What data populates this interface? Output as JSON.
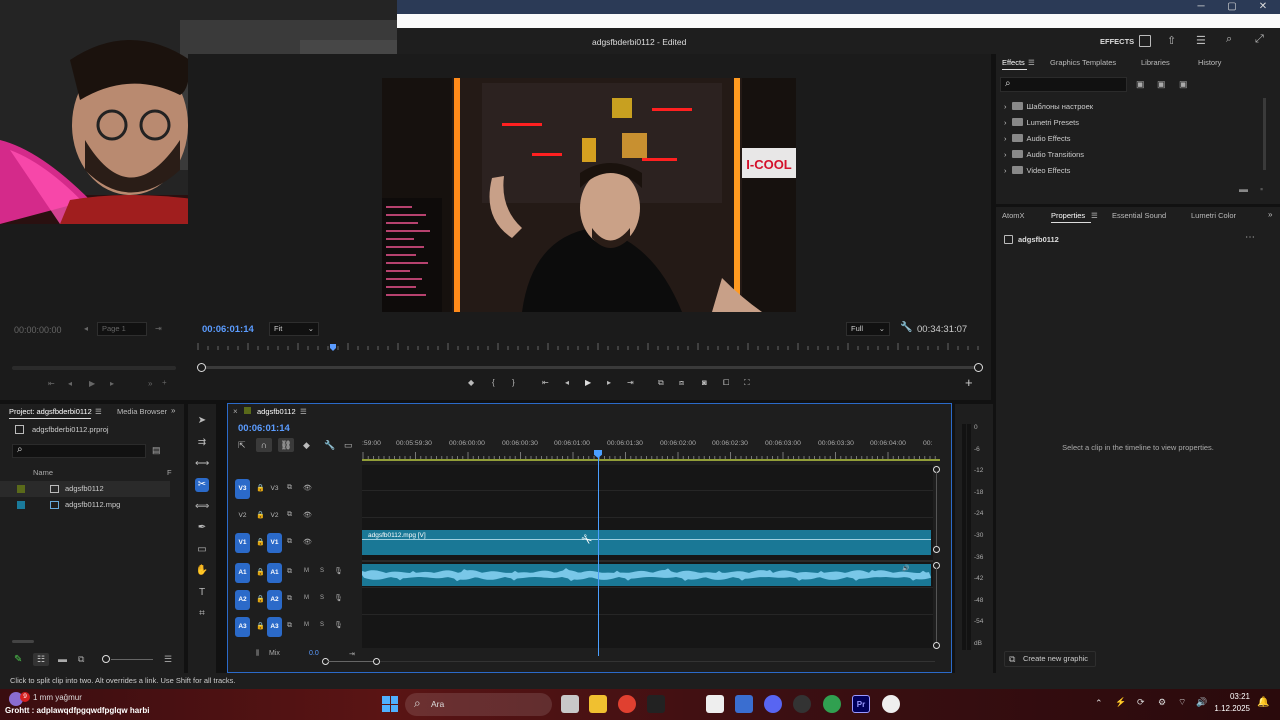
{
  "window": {
    "controls": [
      "─",
      "▢",
      "✕"
    ]
  },
  "header": {
    "title": "adgsfbderbi0112 - Edited",
    "workspace_label": "EFFECTS"
  },
  "source_monitor": {
    "timecode": "00:00:00:00",
    "page_label": "Page 1"
  },
  "program_monitor": {
    "timecode": "00:06:01:14",
    "zoom": "Fit",
    "quality": "Full",
    "duration": "00:34:31:07",
    "overlay_brand": "I-COOL"
  },
  "effects_panel": {
    "tabs": [
      "Effects",
      "Graphics Templates",
      "Libraries",
      "History"
    ],
    "items": [
      "Шаблоны настроек",
      "Lumetri Presets",
      "Audio Effects",
      "Audio Transitions",
      "Video Effects"
    ]
  },
  "properties_panel": {
    "tabs": [
      "AtomX",
      "Properties",
      "Essential Sound",
      "Lumetri Color"
    ],
    "clip_name": "adgsfb0112",
    "empty_message": "Select a clip in the timeline to view properties.",
    "create_graphic": "Create new graphic"
  },
  "project_panel": {
    "title": "Project: adgsfbderbi0112",
    "media_browser": "Media Browser",
    "file": "adgsfbderbi0112.prproj",
    "col_name": "Name",
    "col_f": "F",
    "items": [
      {
        "name": "adgsfb0112",
        "color": "#5a6a1a"
      },
      {
        "name": "adgsfb0112.mpg",
        "color": "#1a7a9a"
      }
    ]
  },
  "timeline": {
    "sequence_name": "adgsfb0112",
    "timecode": "00:06:01:14",
    "ruler": [
      ":59:00",
      "00:05:59:30",
      "00:06:00:00",
      "00:06:00:30",
      "00:06:01:00",
      "00:06:01:30",
      "00:06:02:00",
      "00:06:02:30",
      "00:06:03:00",
      "00:06:03:30",
      "00:06:04:00",
      "00:"
    ],
    "video_tracks": [
      {
        "target": "V3",
        "label": "V3"
      },
      {
        "target": "V2",
        "label": "V2"
      },
      {
        "target": "V1",
        "label": "V1"
      }
    ],
    "audio_tracks": [
      {
        "target": "A1",
        "label": "A1",
        "m": "M",
        "s": "S"
      },
      {
        "target": "A2",
        "label": "A2",
        "m": "M",
        "s": "S"
      },
      {
        "target": "A3",
        "label": "A3",
        "m": "M",
        "s": "S"
      }
    ],
    "video_clip_label": "adgsfb0112.mpg [V]",
    "mix_label": "Mix",
    "mix_value": "0.0"
  },
  "meters": {
    "scale": [
      "0",
      "-6",
      "-12",
      "-18",
      "-24",
      "-30",
      "-36",
      "-42",
      "-48",
      "-54",
      "dB"
    ]
  },
  "status_bar": {
    "text": "Click to split clip into two. Alt overrides a link. Use Shift for all tracks."
  },
  "taskbar": {
    "weather": "1 mm yağmur",
    "badge": "9",
    "stream_text": "Grohtt : adplawqdfpgqwdfpglqw harbi",
    "search_placeholder": "Ara",
    "premiere_label": "Pr",
    "time": "03:21",
    "date": "1.12.2025"
  },
  "colors": {
    "accent": "#2b6ac9",
    "timecode": "#5b9cff",
    "clip": "#1a7896",
    "audio_wave": "#79c7e8",
    "playhead": "#4a9fff"
  }
}
